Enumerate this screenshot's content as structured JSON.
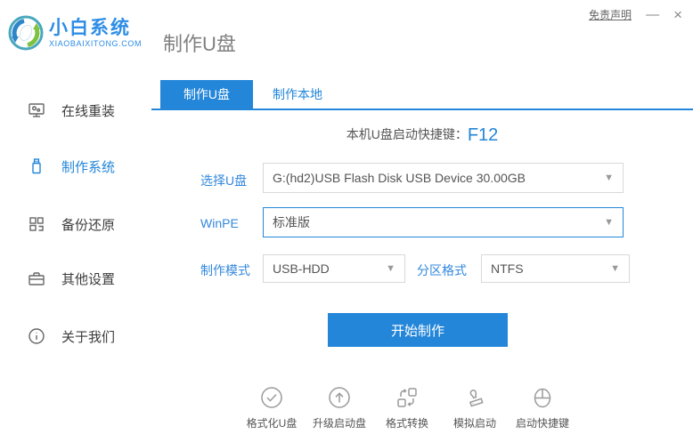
{
  "colors": {
    "accent": "#2386d9",
    "brand_blue": "#2e8de6",
    "title_gray": "#808080",
    "border_gray": "#d9d9d9",
    "icon_gray": "#9a9a9a"
  },
  "window": {
    "disclaimer": "免责声明",
    "minimize": "—",
    "close": "×"
  },
  "header": {
    "brand_name": "小白系统",
    "brand_domain": "XIAOBAIXITONG.COM",
    "page_title": "制作U盘"
  },
  "sidebar": {
    "items": [
      {
        "label": "在线重装",
        "icon": "monitor-reinstall-icon",
        "active": false
      },
      {
        "label": "制作系统",
        "icon": "usb-drive-icon",
        "active": true
      },
      {
        "label": "备份还原",
        "icon": "backup-restore-icon",
        "active": false
      },
      {
        "label": "其他设置",
        "icon": "briefcase-settings-icon",
        "active": false
      },
      {
        "label": "关于我们",
        "icon": "info-icon",
        "active": false
      }
    ]
  },
  "main": {
    "tabs": [
      {
        "label": "制作U盘",
        "active": true
      },
      {
        "label": "制作本地",
        "active": false
      }
    ],
    "hotkey": {
      "label": "本机U盘启动快捷键：",
      "value": "F12"
    },
    "form": {
      "usb": {
        "label": "选择U盘",
        "value": "G:(hd2)USB Flash Disk USB Device 30.00GB"
      },
      "winpe": {
        "label": "WinPE",
        "value": "标准版"
      },
      "mode": {
        "label": "制作模式",
        "value": "USB-HDD"
      },
      "partition": {
        "label": "分区格式",
        "value": "NTFS"
      }
    },
    "start_button": "开始制作",
    "footer_tools": [
      {
        "label": "格式化U盘",
        "icon": "format-usb-icon"
      },
      {
        "label": "升级启动盘",
        "icon": "upgrade-boot-icon"
      },
      {
        "label": "格式转换",
        "icon": "format-convert-icon"
      },
      {
        "label": "模拟启动",
        "icon": "simulate-boot-icon"
      },
      {
        "label": "启动快捷键",
        "icon": "boot-hotkey-icon"
      }
    ]
  }
}
